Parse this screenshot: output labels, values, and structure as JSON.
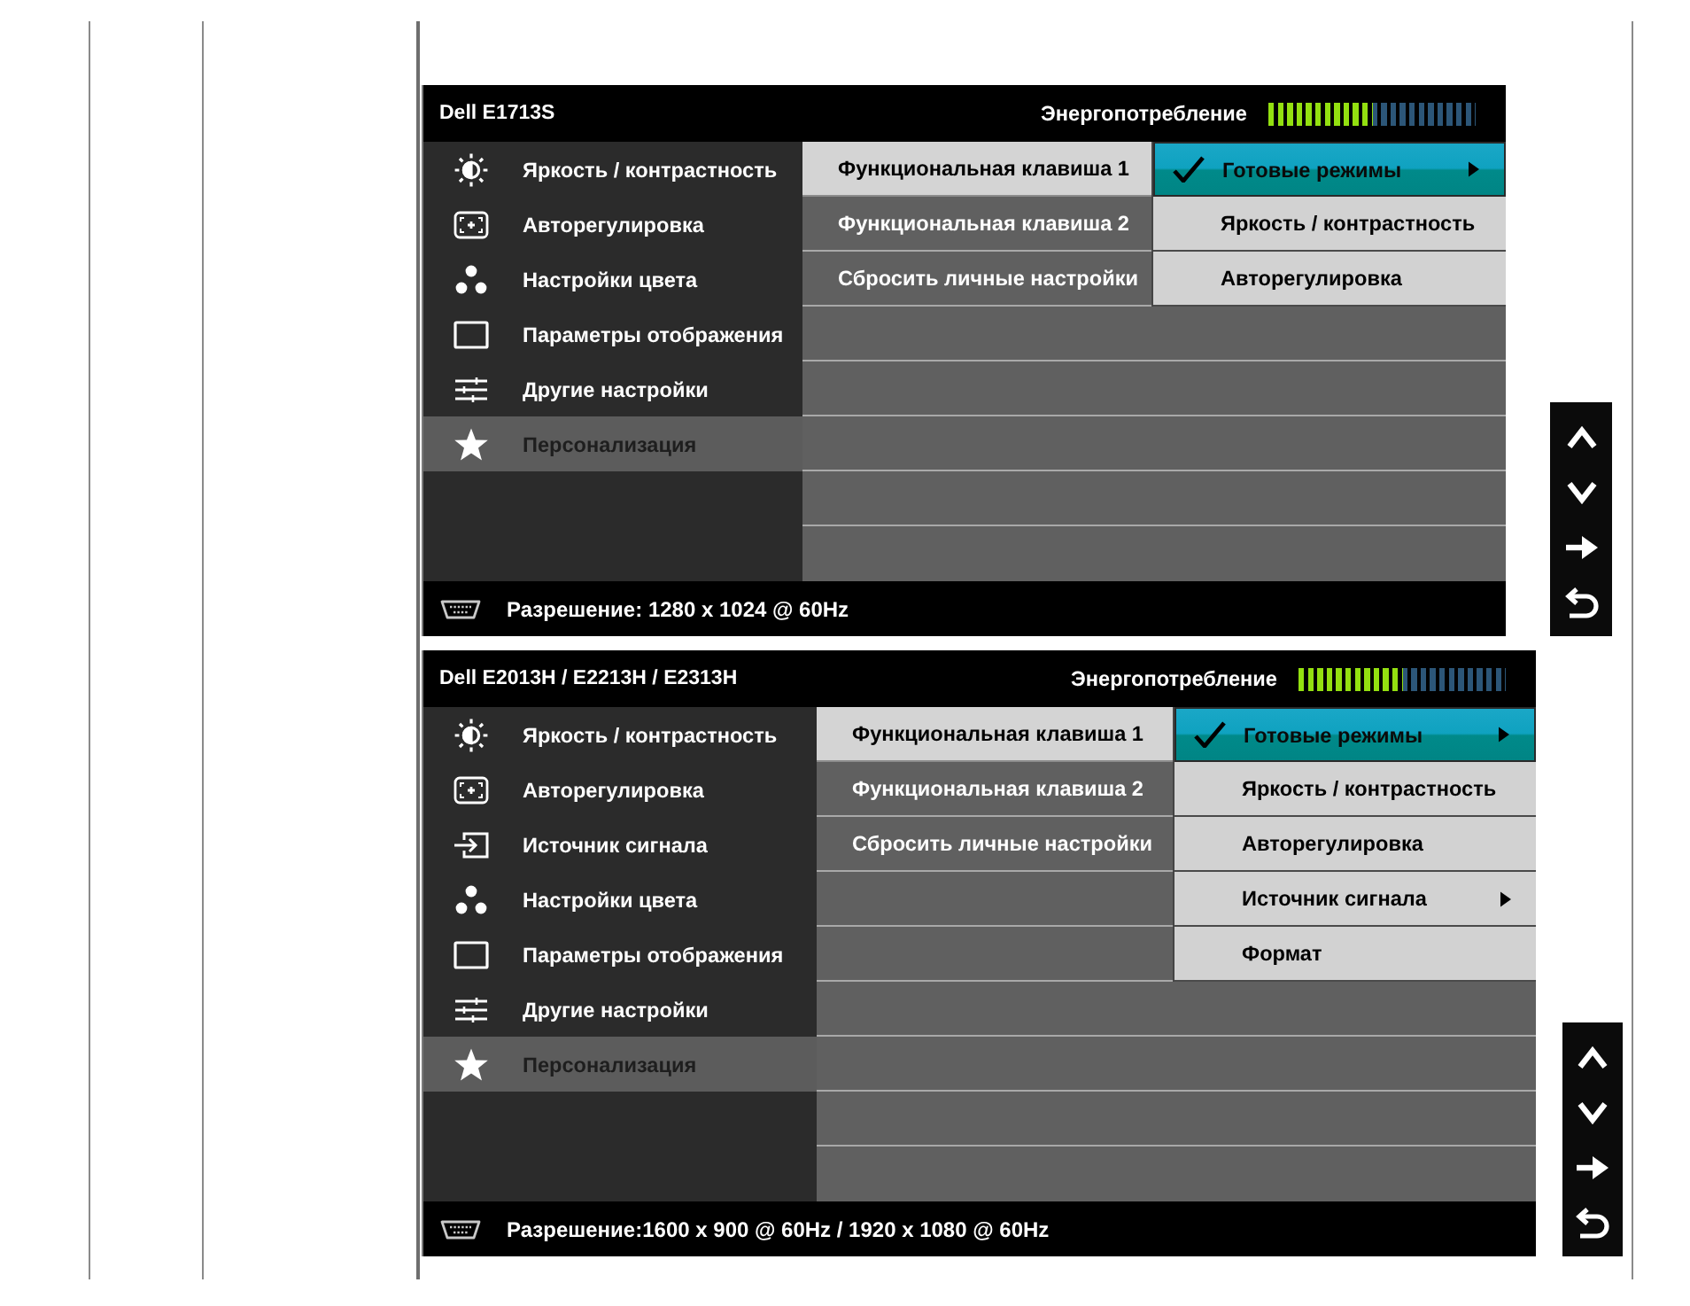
{
  "osds": [
    {
      "model": "Dell E1713S",
      "power": {
        "label": "Энергопотребление",
        "level": 0.5
      },
      "menu": [
        {
          "kind": "brightness",
          "label": "Яркость / контрастность",
          "selected": false
        },
        {
          "kind": "autoadjust",
          "label": "Авторегулировка",
          "selected": false
        },
        {
          "kind": "color",
          "label": "Настройки цвета",
          "selected": false
        },
        {
          "kind": "display",
          "label": "Параметры отображения",
          "selected": false
        },
        {
          "kind": "other",
          "label": "Другие настройки",
          "selected": false
        },
        {
          "kind": "personalize",
          "label": "Персонализация",
          "selected": true
        }
      ],
      "functions": [
        {
          "label": "Функциональная клавиша 1",
          "selected": true
        },
        {
          "label": "Функциональная клавиша 2",
          "selected": false
        },
        {
          "label": "Сбросить личные настройки",
          "selected": false
        }
      ],
      "submenu": [
        {
          "label": "Готовые режимы",
          "selected": true,
          "checked": true,
          "has_submenu": true
        },
        {
          "label": "Яркость / контрастность",
          "selected": false,
          "checked": false,
          "has_submenu": false
        },
        {
          "label": "Авторегулировка",
          "selected": false,
          "checked": false,
          "has_submenu": false
        }
      ],
      "resolution": "Разрешение: 1280 x 1024 @ 60Hz",
      "nav_buttons": [
        {
          "kind": "up"
        },
        {
          "kind": "down"
        },
        {
          "kind": "right"
        },
        {
          "kind": "back"
        }
      ]
    },
    {
      "model": "Dell E2013H / E2213H / E2313H",
      "power": {
        "label": "Энергопотребление",
        "level": 0.5
      },
      "menu": [
        {
          "kind": "brightness",
          "label": "Яркость / контрастность",
          "selected": false
        },
        {
          "kind": "autoadjust",
          "label": "Авторегулировка",
          "selected": false
        },
        {
          "kind": "input",
          "label": "Источник сигнала",
          "selected": false
        },
        {
          "kind": "color",
          "label": "Настройки цвета",
          "selected": false
        },
        {
          "kind": "display",
          "label": "Параметры отображения",
          "selected": false
        },
        {
          "kind": "other",
          "label": "Другие настройки",
          "selected": false
        },
        {
          "kind": "personalize",
          "label": "Персонализация",
          "selected": true
        }
      ],
      "functions": [
        {
          "label": "Функциональная клавиша 1",
          "selected": true
        },
        {
          "label": "Функциональная клавиша 2",
          "selected": false
        },
        {
          "label": "Сбросить личные настройки",
          "selected": false
        }
      ],
      "submenu": [
        {
          "label": "Готовые режимы",
          "selected": true,
          "checked": true,
          "has_submenu": true
        },
        {
          "label": "Яркость / контрастность",
          "selected": false,
          "checked": false,
          "has_submenu": false
        },
        {
          "label": "Авторегулировка",
          "selected": false,
          "checked": false,
          "has_submenu": false
        },
        {
          "label": "Источник сигнала",
          "selected": false,
          "checked": false,
          "has_submenu": true
        },
        {
          "label": "Формат",
          "selected": false,
          "checked": false,
          "has_submenu": false
        }
      ],
      "resolution": "Разрешение:1600 x 900 @ 60Hz / 1920 x 1080 @ 60Hz",
      "nav_buttons": [
        {
          "kind": "up"
        },
        {
          "kind": "down"
        },
        {
          "kind": "right"
        },
        {
          "kind": "back"
        }
      ]
    }
  ]
}
